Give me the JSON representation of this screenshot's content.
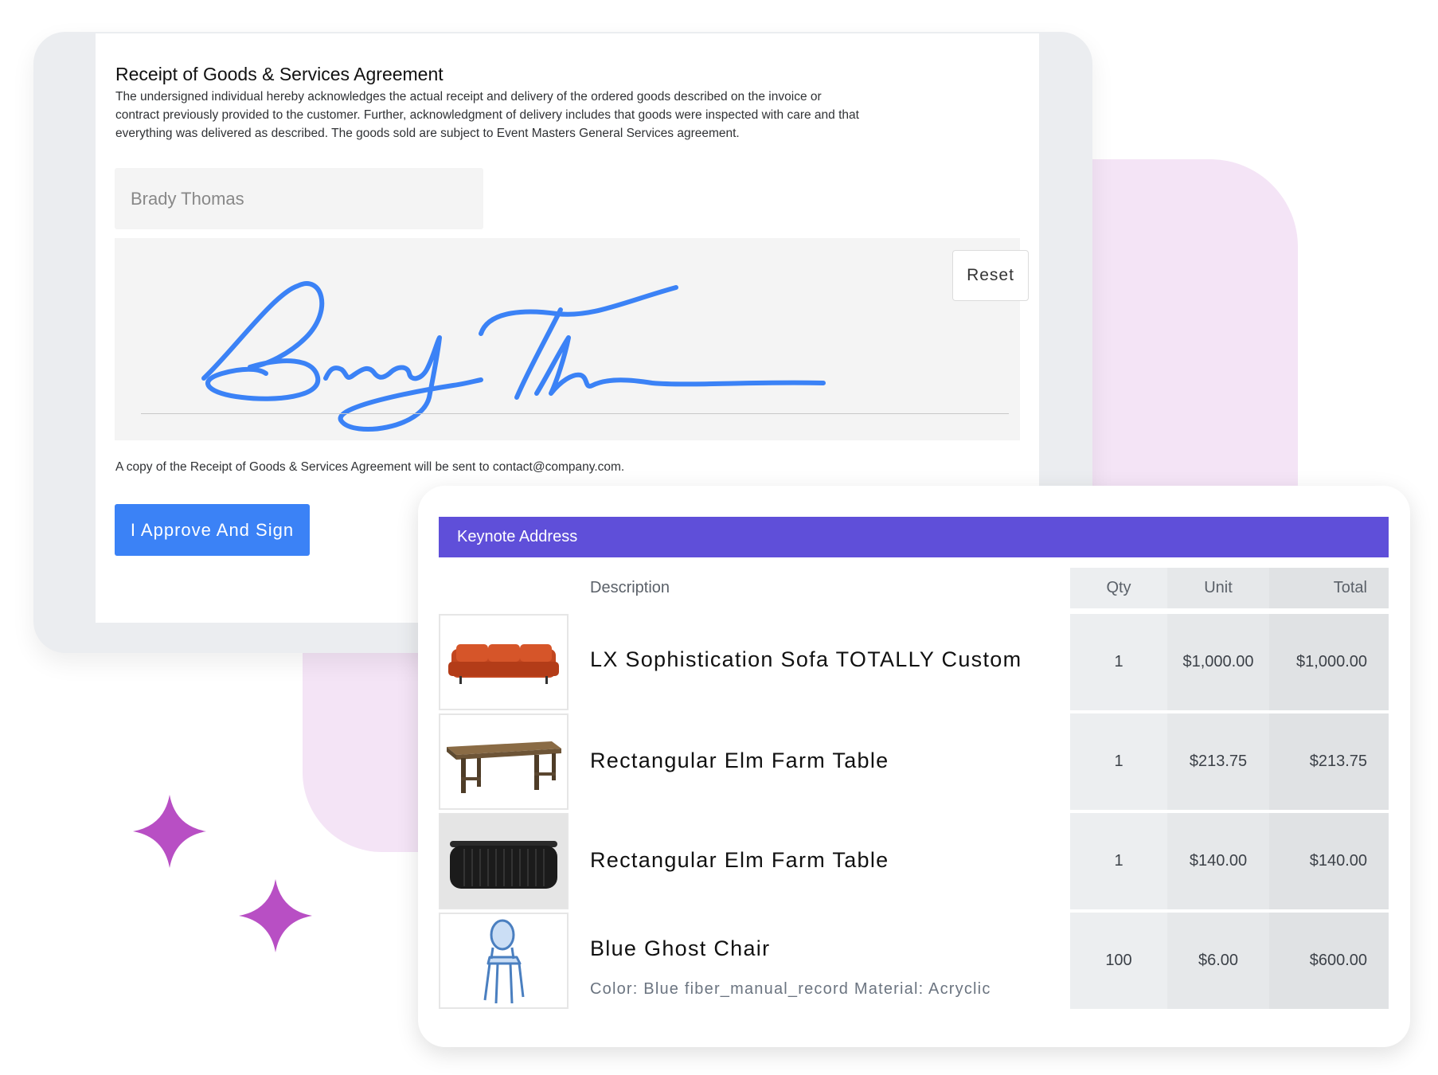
{
  "agreement": {
    "title": "Receipt of Goods & Services Agreement",
    "body": "The undersigned individual hereby acknowledges the actual receipt and delivery of the ordered goods described on the invoice or contract previously provided to the customer. Further, acknowledgment of delivery includes that goods were inspected with care and that everything was delivered as described. The goods sold are subject to Event Masters General Services agreement.",
    "name_placeholder": "Brady Thomas",
    "reset_label": "Reset",
    "copy_note": "A copy of the Receipt of Goods & Services Agreement will be sent to contact@company.com.",
    "approve_label": "I Approve And Sign",
    "accent_color": "#3b82f6"
  },
  "order": {
    "header": "Keynote Address",
    "header_color": "#5f4fd9",
    "columns": {
      "description": "Description",
      "qty": "Qty",
      "unit": "Unit",
      "total": "Total"
    },
    "items": [
      {
        "name": "LX Sophistication Sofa TOTALLY Custom",
        "meta": "",
        "image": "orange-sofa",
        "qty": "1",
        "unit": "$1,000.00",
        "total": "$1,000.00"
      },
      {
        "name": "Rectangular Elm Farm Table",
        "meta": "",
        "image": "wood-farm-table",
        "qty": "1",
        "unit": "$213.75",
        "total": "$213.75"
      },
      {
        "name": "Rectangular Elm Farm Table",
        "meta": "",
        "image": "black-fluted-table",
        "qty": "1",
        "unit": "$140.00",
        "total": "$140.00"
      },
      {
        "name": "Blue Ghost Chair",
        "meta": "Color: Blue fiber_manual_record Material: Acryclic",
        "image": "blue-ghost-chair",
        "qty": "100",
        "unit": "$6.00",
        "total": "$600.00"
      }
    ]
  },
  "decoration": {
    "sparkle_color": "#b84fc4",
    "blob_color": "#f4e4f6"
  }
}
